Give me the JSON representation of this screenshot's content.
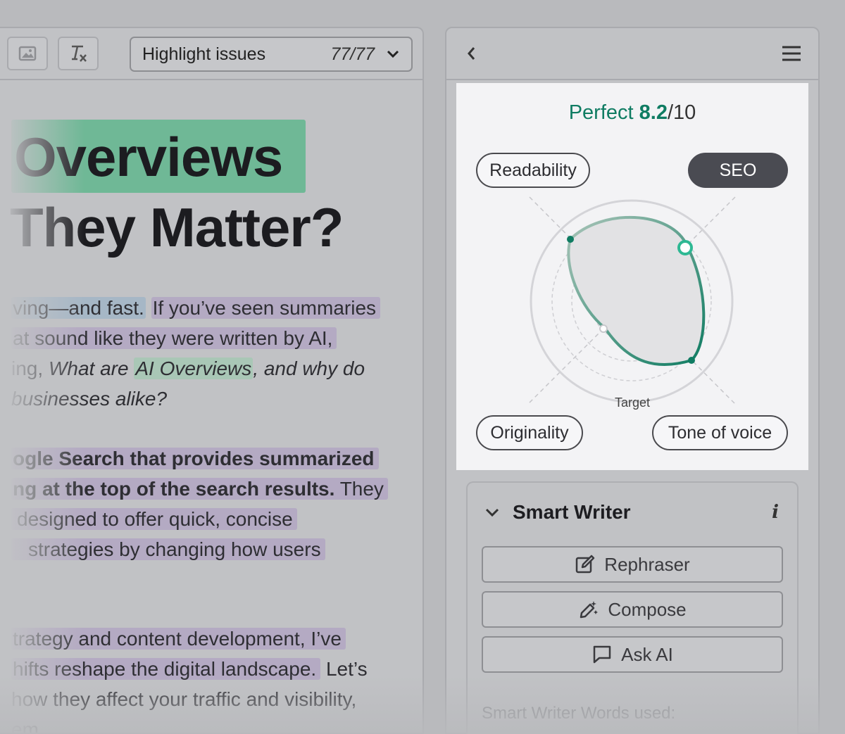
{
  "editor": {
    "toolbar": {
      "highlight_label": "Highlight issues",
      "highlight_count": "77/77"
    },
    "heading_line1": "Overviews",
    "heading_line2": "They Matter?",
    "paragraph1": {
      "l1a": "ving—and fast.",
      "l1b": "If you’ve seen summaries",
      "l2": "at sound like they were written by AI,",
      "l3a": "ing,",
      "l3b": "What are",
      "l3c": "AI Overviews",
      "l3d": ", and why do",
      "l4": "businesses alike?"
    },
    "paragraph2": {
      "l1": "ogle Search that provides summarized",
      "l2a": "ng at the top of the search results.",
      "l2b": "They",
      "l3": "designed to offer quick, concise",
      "l4": "strategies by changing how users"
    },
    "paragraph3": {
      "l1": "trategy and content development, I’ve",
      "l2a": "hifts reshape the digital landscape.",
      "l2b": "Let’s",
      "l3": "how they affect your traffic and visibility,",
      "l4": "em."
    }
  },
  "score": {
    "label": "Perfect",
    "value": "8.2",
    "denominator": "/10",
    "value_numeric": 8.2,
    "max": 10,
    "accent_color": "#0f7c62"
  },
  "radar": {
    "target_label": "Target",
    "axes": {
      "readability": "Readability",
      "seo": "SEO",
      "originality": "Originality",
      "tone": "Tone of voice"
    },
    "selected_axis": "SEO"
  },
  "smart_writer": {
    "title": "Smart Writer",
    "info": "i",
    "rephraser": "Rephraser",
    "compose": "Compose",
    "ask_ai": "Ask AI",
    "footer": "Smart Writer Words used:"
  }
}
